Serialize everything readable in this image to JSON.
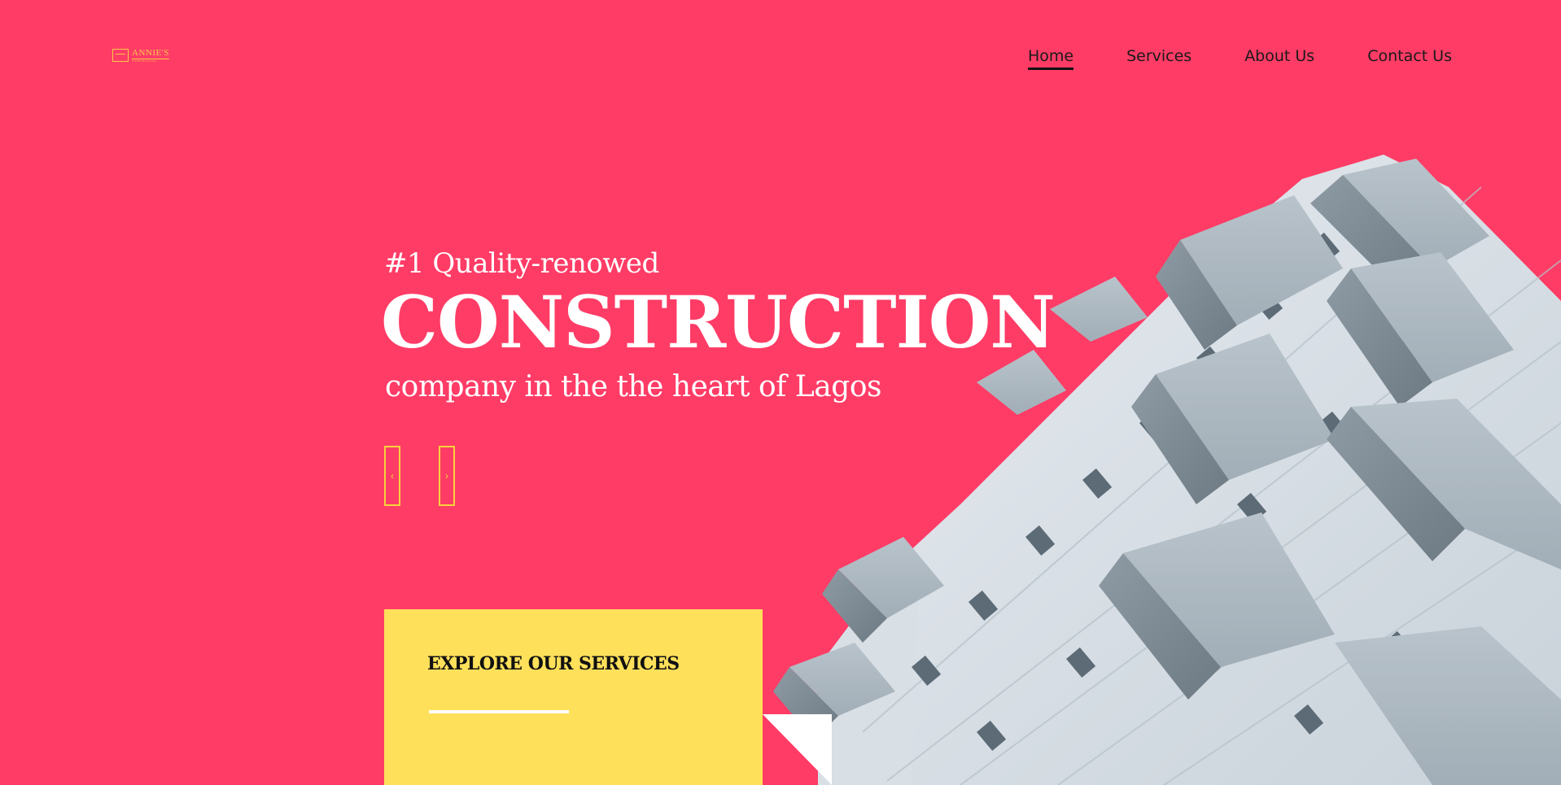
{
  "logo": {
    "name": "ANNIE'S",
    "tagline": "CONSTRUCTION"
  },
  "nav": {
    "items": [
      {
        "label": "Home",
        "active": true
      },
      {
        "label": "Services",
        "active": false
      },
      {
        "label": "About Us",
        "active": false
      },
      {
        "label": "Contact Us",
        "active": false
      }
    ]
  },
  "hero": {
    "kicker": "#1 Quality-renowed",
    "title": "CONSTRUCTION",
    "subtitle": "company in the the heart of Lagos"
  },
  "slider": {
    "prev_icon": "‹",
    "next_icon": "›"
  },
  "explore": {
    "label": "EXPLORE OUR SERVICES"
  },
  "colors": {
    "background": "#ff3c66",
    "accent_yellow": "#ffe05a",
    "text": "#ffffff"
  },
  "icons": {
    "prev": "chevron-left-icon",
    "next": "chevron-right-icon",
    "logo": "logo-icon"
  }
}
